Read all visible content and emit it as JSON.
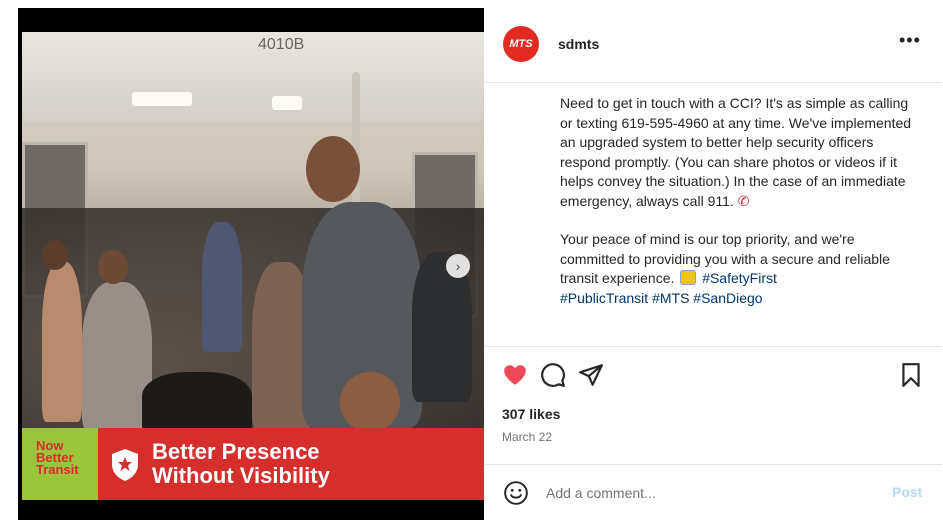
{
  "media": {
    "banner": {
      "tag_lines": [
        "Now",
        "Better",
        "Transit"
      ],
      "headline_lines": [
        "Better Presence",
        "Without Visibility"
      ],
      "shield_icon": "shield-icon"
    },
    "photo_sign": "4010B",
    "next_icon": "chevron-right-icon"
  },
  "post": {
    "avatar_text": "MTS",
    "username": "sdmts",
    "more_icon": "ellipsis-icon",
    "caption": {
      "p1": "Need to get in touch with a CCI? It's as simple as calling or texting 619-595-4960 at any time. We've implemented an upgraded system to better help security officers respond promptly. (You can share photos or videos if it helps convey the situation.) In the case of an immediate emergency, always call 911. ",
      "p2_text": "Your peace of mind is our top priority, and we're committed to providing you with a secure and reliable transit experience. ",
      "hashtags_line1": "#SafetyFirst",
      "hashtags_line2": "#PublicTransit #MTS #SanDiego"
    },
    "likes": "307 likes",
    "date": "March 22",
    "comment_placeholder": "Add a comment...",
    "post_label": "Post"
  },
  "colors": {
    "like_red": "#ed4956",
    "brand_red": "#d62e2a",
    "tag_green": "#9cc43a",
    "hashtag_blue": "#00376b",
    "post_disabled": "#b3dbff"
  },
  "icons": {
    "like": "heart-icon",
    "comment": "comment-icon",
    "share": "send-icon",
    "save": "bookmark-icon",
    "emoji": "emoji-icon",
    "phone": "phone-icon",
    "bus": "bus-icon"
  }
}
